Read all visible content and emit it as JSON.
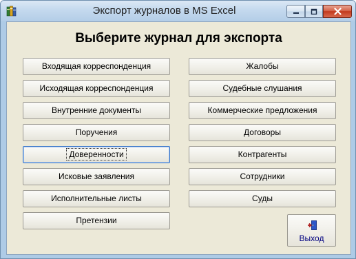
{
  "window": {
    "title": "Экспорт журналов в MS Excel",
    "icon": "books-icon",
    "controls": {
      "minimize": "minimize-icon",
      "maximize": "maximize-icon",
      "close": "close-icon"
    }
  },
  "heading": "Выберите журнал для экспорта",
  "left_buttons": [
    "Входящая корреспонденция",
    "Исходящая корреспонденция",
    "Внутренние документы",
    "Поручения",
    "Доверенности",
    "Исковые заявления",
    "Исполнительные листы",
    "Претензии"
  ],
  "right_buttons": [
    "Жалобы",
    "Судебные слушания",
    "Коммерческие предложения",
    "Договоры",
    "Контрагенты",
    "Сотрудники",
    "Суды"
  ],
  "focused_button": "Доверенности",
  "exit": {
    "label": "Выход",
    "icon": "exit-door-icon"
  },
  "colors": {
    "title_bar": "#b7d0e8",
    "client_bg": "#ece9d8",
    "close_btn": "#c2391d",
    "exit_label": "#000080"
  }
}
